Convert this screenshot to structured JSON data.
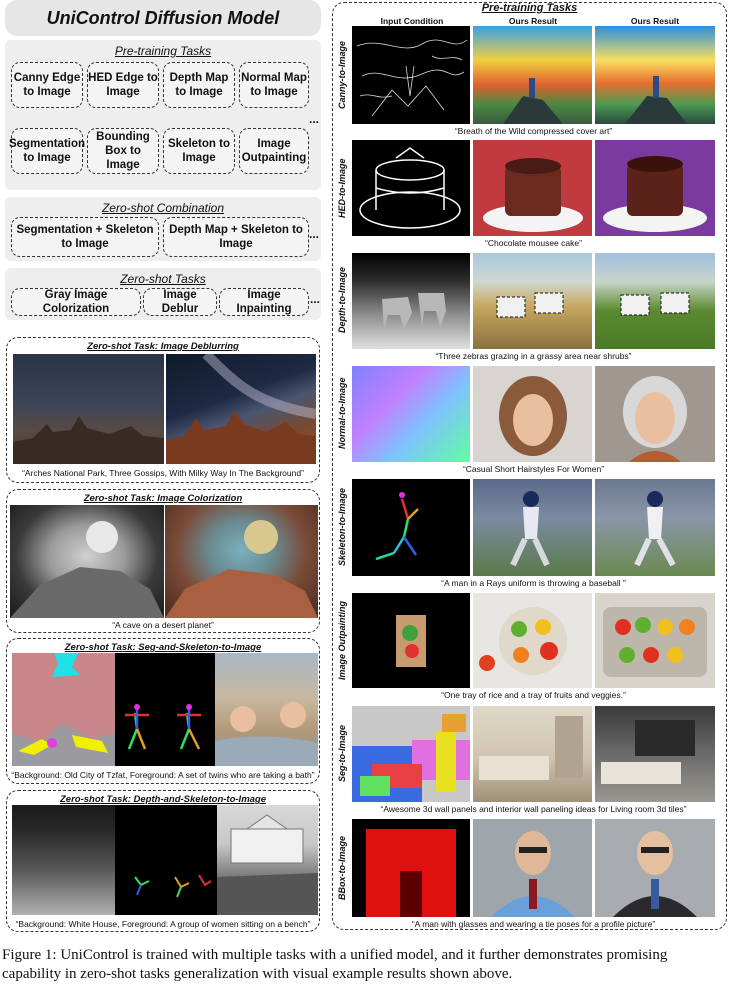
{
  "header": {
    "title": "UniControl Diffusion Model"
  },
  "pretraining": {
    "title": "Pre-training Tasks",
    "tasks": [
      "Canny Edge to Image",
      "HED Edge to Image",
      "Depth Map to Image",
      "Normal Map to Image",
      "Segmentation to Image",
      "Bounding Box to Image",
      "Skeleton to Image",
      "Image Outpainting"
    ],
    "ellipsis": "..."
  },
  "combination": {
    "title": "Zero-shot Combination",
    "tasks": [
      "Segmentation + Skeleton to Image",
      "Depth Map + Skeleton to Image"
    ],
    "ellipsis": "..."
  },
  "zeroshot": {
    "title": "Zero-shot Tasks",
    "tasks": [
      "Gray Image Colorization",
      "Image Deblur",
      "Image Inpainting"
    ],
    "ellipsis": "..."
  },
  "panels": [
    {
      "title": "Zero-shot Task: Image Deblurring",
      "caption": "“Arches National Park, Three Gossips, With Milky Way In The Background”"
    },
    {
      "title": "Zero-shot Task: Image Colorization",
      "caption": "“A cave on a desert planet”"
    },
    {
      "title": "Zero-shot Task: Seg-and-Skeleton-to-Image",
      "caption": "“Background: Old City of Tzfat, Foreground: A set of twins who are taking a bath”"
    },
    {
      "title": "Zero-shot Task: Depth-and-Skeleton-to-Image",
      "caption": "“Background: White House, Foreground: A group of women sitting on a bench”"
    }
  ],
  "right": {
    "title": "Pre-training Tasks",
    "col_heads": [
      "Input Condition",
      "Ours Result",
      "Ours Result"
    ],
    "rows": [
      {
        "label": "Canny-to-Image",
        "caption": "“Breath of the Wild compressed cover art”"
      },
      {
        "label": "HED-to-Image",
        "caption": "“Chocolate mousee cake”"
      },
      {
        "label": "Depth-to-Image",
        "caption": "“Three zebras grazing in a grassy area near shrubs”"
      },
      {
        "label": "Normal-to-Image",
        "caption": "“Casual Short Hairstyles For Women”"
      },
      {
        "label": "Skeleton-to-Image",
        "caption": "“A man in a Rays uniform is throwing a baseball ”"
      },
      {
        "label": "Image Outpainting",
        "caption": "“One tray of rice and a tray of fruits and veggies.”"
      },
      {
        "label": "Seg-to-Image",
        "caption": "“Awesome 3d wall panels and interior wall paneling ideas for Living room 3d tiles”"
      },
      {
        "label": "BBox-to-Image",
        "caption": "“A man with glasses and wearing a tie poses for a profile picture”"
      }
    ]
  },
  "figure_caption": "Figure 1: UniControl is trained with multiple tasks with a unified model, and it further demonstrates promising capability in zero-shot tasks generalization with visual example results shown above."
}
